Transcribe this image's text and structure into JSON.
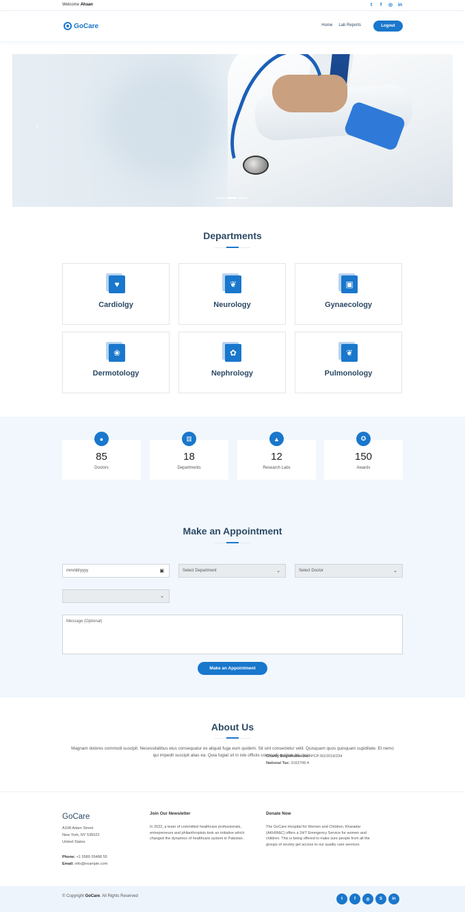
{
  "topbar": {
    "welcome_prefix": "Welcome",
    "user": "Ahsan",
    "social": [
      "twitter-icon",
      "facebook-icon",
      "instagram-icon",
      "linkedin-icon"
    ]
  },
  "header": {
    "brand": "GoCare",
    "nav": [
      "Home",
      "Lab Reports"
    ],
    "logout": "Logout"
  },
  "departments": {
    "title": "Departments",
    "items": [
      {
        "name": "Cardiolgy",
        "icon": "heart-pulse-icon"
      },
      {
        "name": "Neurology",
        "icon": "brain-icon"
      },
      {
        "name": "Gynaecology",
        "icon": "hospital-user-icon"
      },
      {
        "name": "Dermotology",
        "icon": "hands-icon"
      },
      {
        "name": "Nephrology",
        "icon": "lungs-icon"
      },
      {
        "name": "Pulmonology",
        "icon": "lungs-icon"
      }
    ]
  },
  "stats": [
    {
      "value": "85",
      "label": "Doctors",
      "icon": "user-md-icon"
    },
    {
      "value": "18",
      "label": "Departments",
      "icon": "hospital-icon"
    },
    {
      "value": "12",
      "label": "Research Labs",
      "icon": "flask-icon"
    },
    {
      "value": "150",
      "label": "Awards",
      "icon": "award-icon"
    }
  ],
  "appointment": {
    "title": "Make an Appointment",
    "date_placeholder": "mm/dd/yyyy",
    "department_select": "Select Department",
    "doctor_select": "Select Doctor",
    "time_select": "",
    "message_placeholder": "Message (Optional)",
    "submit": "Make an Appointment"
  },
  "about": {
    "title": "About Us",
    "text": "Magnam dolores commodi suscipit. Necessitatibus eius consequatur ex aliquid fuga eum quidem. Sit sint consectetur velit. Quisquam quos quisquam cupiditate. Et nemo qui impedit suscipit alias ea. Quia fugiat sit in iste officiis commodi quidem hic quas."
  },
  "footer": {
    "brand": "GoCare",
    "address": [
      "A108 Adam Street",
      "New York, NY 535022",
      "United States"
    ],
    "phone_label": "Phone:",
    "phone": "+1 5589 55488 55",
    "email_label": "Email:",
    "email": "info@example.com",
    "newsletter_title": "Join Our Newsletter",
    "newsletter_text": "In 2022, a team of committed healthcare professionals, entrepreneurs and philanthropists took an initiative which changed the dynamics of healthcare system in Pakistan.",
    "donate_title": "Donate Now",
    "donate_text": "The GoCare Hospital for Women and Children, Kharadar (AKHW&C) offers a 24/7 Emergency Service for women and children. This is being offered to make sure people from all the groups of society get access to our quality care services.",
    "charity_label": "Charity Registration No:",
    "charity": "PCP-R2/2019/234",
    "tax_label": "National Tax:",
    "tax": "3162706-4",
    "copyright_prefix": "© Copyright",
    "copyright_brand": "GoCare",
    "copyright_suffix": ". All Rights Reserved",
    "social": [
      "twitter-icon",
      "facebook-icon",
      "instagram-icon",
      "skype-icon",
      "linkedin-icon"
    ]
  },
  "colors": {
    "accent": "#1977cc",
    "heading": "#2c4964",
    "band": "#f1f7fd"
  }
}
